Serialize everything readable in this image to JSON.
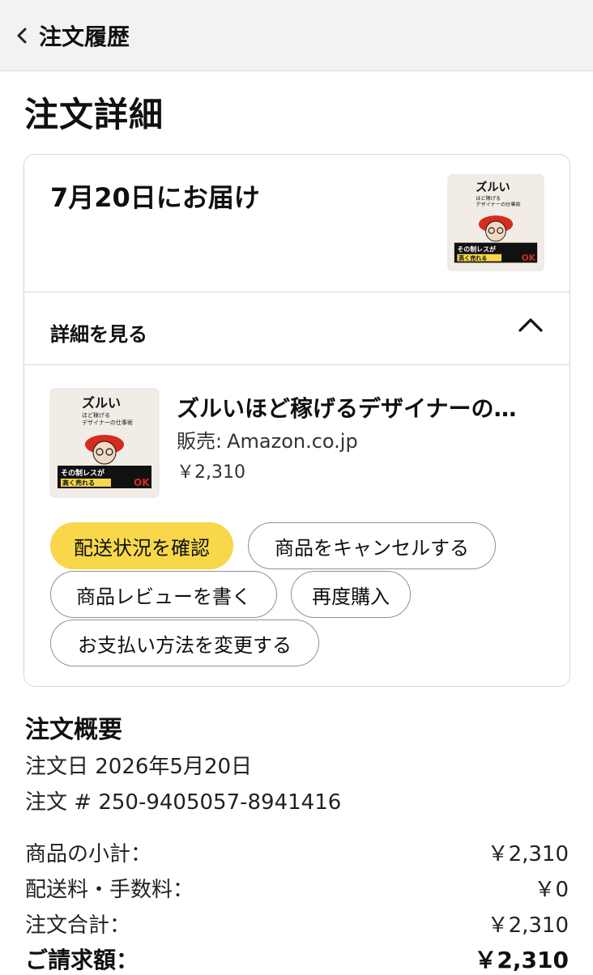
{
  "header": {
    "back_label": "注文履歴"
  },
  "page": {
    "title": "注文詳細"
  },
  "shipment": {
    "delivery_label": "7月20日にお届け",
    "details_toggle_label": "詳細を見る"
  },
  "book_cover": {
    "title_big": "ズルい",
    "title_sub": "ほど稼げる",
    "title_sub2": "デザイナーの仕事術",
    "banner": "その制レスが",
    "banner2": "高く売れる",
    "ok": "OK"
  },
  "item": {
    "title": "ズルいほど稼げるデザイナーの…",
    "seller_label": "販売:",
    "seller_value": "Amazon.co.jp",
    "price": "￥2,310"
  },
  "actions": {
    "track": "配送状況を確認",
    "cancel": "商品をキャンセルする",
    "review": "商品レビューを書く",
    "rebuy": "再度購入",
    "change_payment": "お支払い方法を変更する"
  },
  "summary": {
    "title": "注文概要",
    "order_date": "注文日 2026年5月20日",
    "order_number": "注文 # 250-9405057-8941416",
    "rows": [
      {
        "label": "商品の小計：",
        "value": "￥2,310"
      },
      {
        "label": "配送料・手数料：",
        "value": "￥0"
      },
      {
        "label": "注文合計：",
        "value": "￥2,310"
      },
      {
        "label": "ご請求額：",
        "value": "￥2,310"
      }
    ]
  },
  "colors": {
    "primary_button": "#f8d84a",
    "border": "#d5d9d9",
    "header_bg": "#f2f2f2",
    "cover_red": "#d62b1e"
  }
}
